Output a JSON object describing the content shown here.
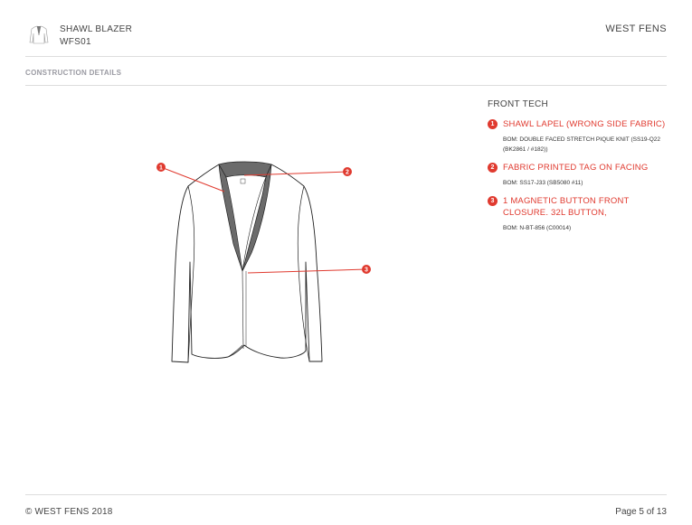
{
  "header": {
    "product_name": "SHAWL BLAZER",
    "product_code": "WFS01",
    "brand": "WEST FENS",
    "thumbnail_icon": "blazer-sketch-icon"
  },
  "section_title": "CONSTRUCTION DETAILS",
  "drawing": {
    "pointer_color": "#e03a2f",
    "lapel_color": "#6b6b6b",
    "markers": [
      "1",
      "2",
      "3"
    ]
  },
  "panel": {
    "title": "FRONT TECH",
    "callouts": [
      {
        "number": "1",
        "title": "SHAWL LAPEL (WRONG SIDE FABRIC)",
        "bom": "BOM: DOUBLE FACED STRETCH PIQUE KNIT (SS19-Q22 (BK2861 / #182))"
      },
      {
        "number": "2",
        "title": "FABRIC PRINTED TAG ON FACING",
        "bom": "BOM: SS17-J33 (SB5080 #11)"
      },
      {
        "number": "3",
        "title": "1 MAGNETIC BUTTON FRONT CLOSURE. 32L BUTTON,",
        "bom": "BOM: N-BT-856 (C00014)"
      }
    ]
  },
  "footer": {
    "copyright": "©  WEST FENS  2018",
    "page": "Page 5 of 13"
  }
}
